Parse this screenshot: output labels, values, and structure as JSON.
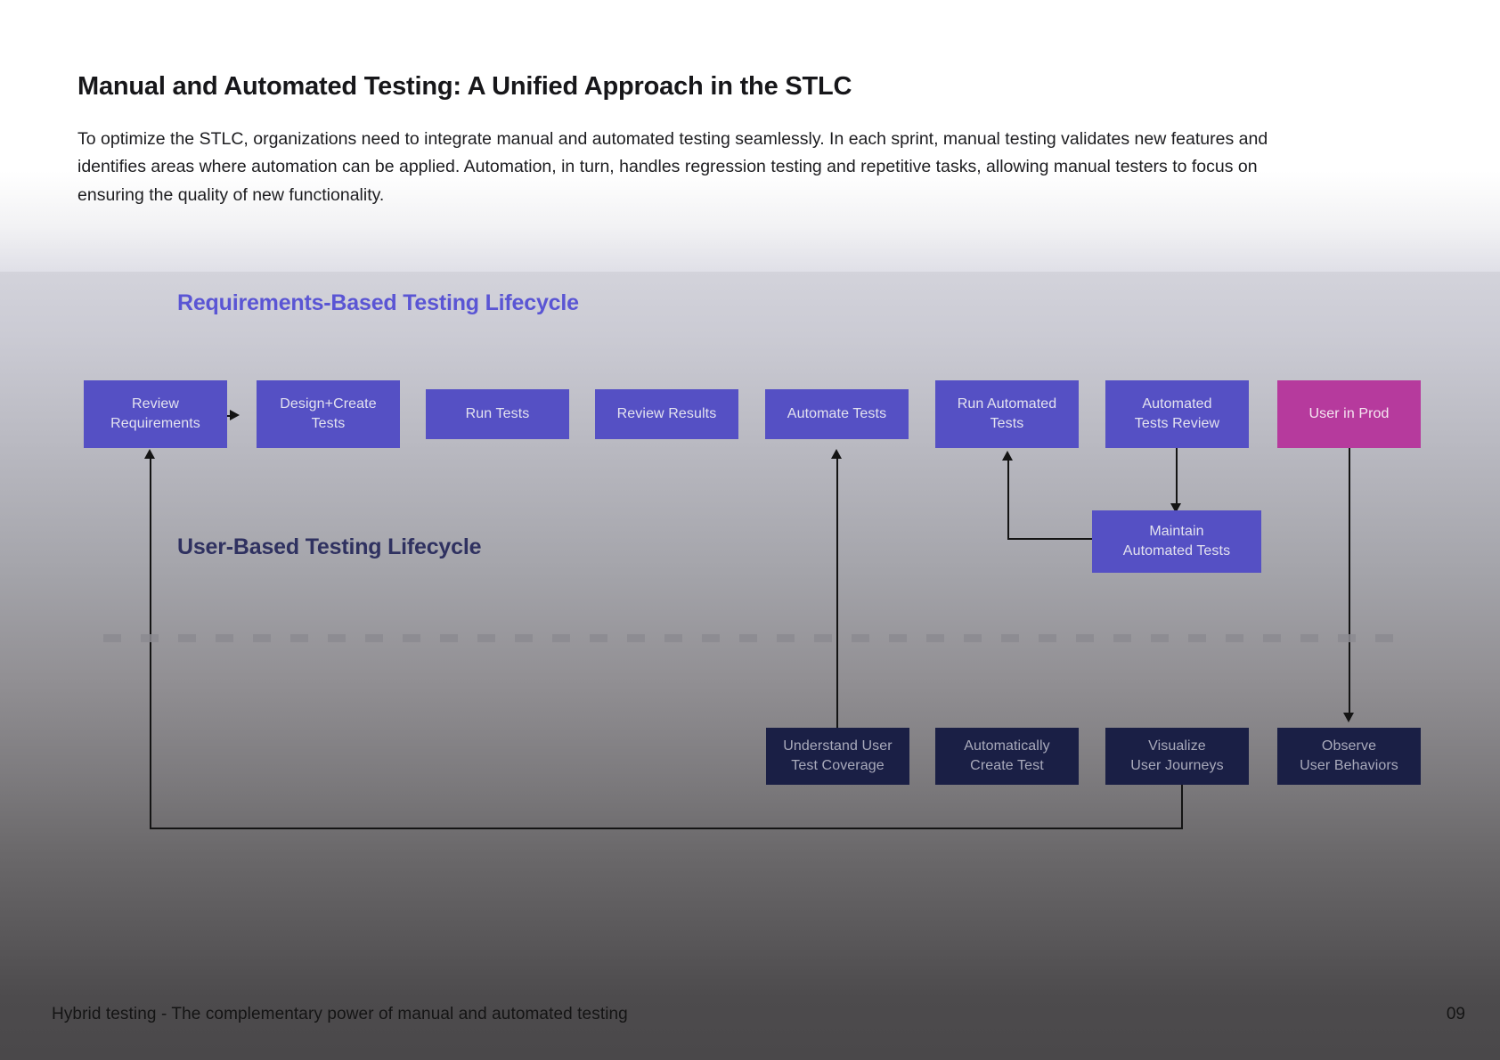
{
  "slide": {
    "title": "Manual and Automated Testing: A Unified Approach in the STLC",
    "body": "To optimize the STLC, organizations need to integrate manual and automated testing seamlessly. In each sprint, manual testing validates new features and identifies areas where automation can be applied. Automation, in turn, handles regression testing and repetitive tasks, allowing manual testers to focus on ensuring the quality of new functionality."
  },
  "diagram": {
    "section_labels": {
      "requirements": "Requirements-Based Testing Lifecycle",
      "user": "User-Based Testing Lifecycle"
    },
    "colors": {
      "requirements_label": "#5a55d4",
      "user_label": "#2f3160",
      "node_requirements": "#5550c4",
      "node_production": "#b63a9d",
      "node_user": "#1a1f45",
      "connector": "#141414",
      "divider": "#8b8a90"
    },
    "requirements_nodes": [
      {
        "id": "review-requirements",
        "label": "Review\nRequirements"
      },
      {
        "id": "design-create-tests",
        "label": "Design+Create\nTests"
      },
      {
        "id": "run-tests",
        "label": "Run Tests"
      },
      {
        "id": "review-results",
        "label": "Review Results"
      },
      {
        "id": "automate-tests",
        "label": "Automate Tests"
      },
      {
        "id": "run-automated-tests",
        "label": "Run Automated\nTests"
      },
      {
        "id": "automated-tests-review",
        "label": "Automated\nTests Review"
      },
      {
        "id": "user-in-prod",
        "label": "User in Prod"
      }
    ],
    "maintain_node": {
      "id": "maintain-automated-tests",
      "label": "Maintain\nAutomated Tests"
    },
    "user_nodes": [
      {
        "id": "understand-user-test-coverage",
        "label": "Understand User\nTest Coverage"
      },
      {
        "id": "automatically-create-test",
        "label": "Automatically\nCreate Test"
      },
      {
        "id": "visualize-user-journeys",
        "label": "Visualize\nUser Journeys"
      },
      {
        "id": "observe-user-behaviors",
        "label": "Observe\nUser Behaviors"
      }
    ]
  },
  "footer": {
    "caption": "Hybrid testing - The complementary power of manual and automated testing",
    "page": "09"
  }
}
